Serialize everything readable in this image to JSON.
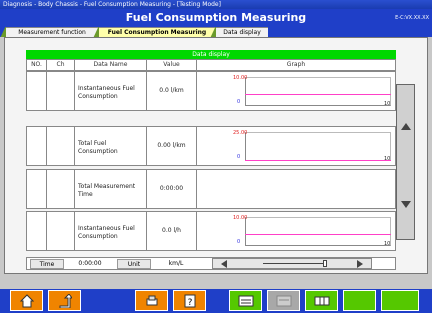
{
  "window": {
    "title": "Diagnosis - Body Chassis - Fuel Consumption Measuring - [Testing Mode]",
    "version": "E-C:VX.XX.XX"
  },
  "header": {
    "title": "Fuel Consumption Measuring"
  },
  "tabs": [
    {
      "label": "Measurement function",
      "active": false
    },
    {
      "label": "Fuel Consumption Measuring",
      "active": true
    },
    {
      "label": "Data display",
      "active": false
    }
  ],
  "grid": {
    "title": "Data display",
    "columns": [
      "NO.",
      "Ch",
      "Data Name",
      "Value",
      "Graph"
    ],
    "rows": [
      {
        "name": "Instantaneous Fuel Consumption",
        "value": "0.0 l/km",
        "graph": {
          "max": "10.00",
          "min": "0",
          "end": "10"
        }
      },
      {
        "name": "Total Fuel Consumption",
        "value": "0.00 l/km",
        "graph": {
          "max": "25.00",
          "min": "0",
          "end": "10"
        }
      },
      {
        "name": "Total Measurement Time",
        "value": "0:00:00",
        "graph": null
      },
      {
        "name": "Instantaneous Fuel Consumption",
        "value": "0.0 l/h",
        "graph": {
          "max": "10.00",
          "min": "0",
          "end": "10"
        }
      }
    ]
  },
  "footer": {
    "time_label": "Time",
    "time_value": "0:00:00",
    "unit_label": "Unit",
    "unit_value": "km/L"
  },
  "toolbar": {
    "buttons": [
      {
        "name": "home-button",
        "icon": "home-icon",
        "color": "orange"
      },
      {
        "name": "back-button",
        "icon": "back-arrow-icon",
        "color": "orange"
      },
      {
        "name": "print-button",
        "icon": "printer-icon",
        "color": "orange"
      },
      {
        "name": "help-button",
        "icon": "help-icon",
        "color": "orange"
      },
      {
        "name": "graph-button",
        "icon": "screen-icon",
        "color": "green"
      },
      {
        "name": "disabled-button",
        "icon": "screen-icon",
        "color": "gray"
      },
      {
        "name": "table-button",
        "icon": "table-icon",
        "color": "green"
      },
      {
        "name": "empty-button-1",
        "icon": "",
        "color": "green"
      },
      {
        "name": "empty-button-2",
        "icon": "",
        "color": "green"
      }
    ]
  },
  "colors": {
    "accent": "#1f3fc8",
    "grid_title": "#00d800",
    "tab_active": "#ffffaa",
    "button_orange": "#f08400",
    "button_green": "#55c800",
    "graph_line": "#ff40c8"
  }
}
